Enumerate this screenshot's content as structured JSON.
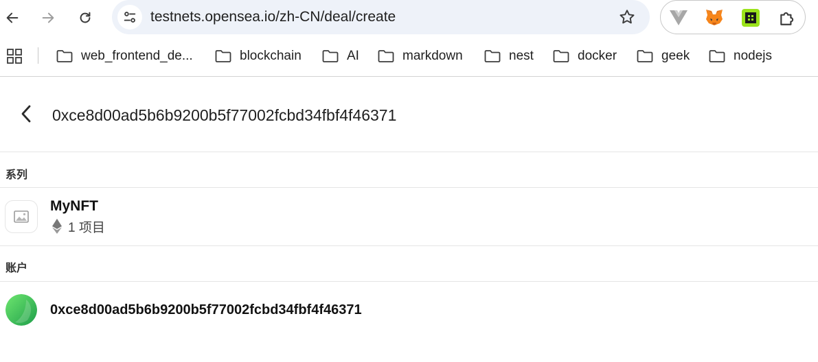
{
  "browser": {
    "url": "testnets.opensea.io/zh-CN/deal/create",
    "extensions": [
      "vue-devtools-icon",
      "metamask-fox-icon",
      "green-square-extension-icon",
      "puzzle-piece-icon"
    ],
    "bookmarks": [
      {
        "label": "web_frontend_de..."
      },
      {
        "label": "blockchain"
      },
      {
        "label": "AI"
      },
      {
        "label": "markdown"
      },
      {
        "label": "nest"
      },
      {
        "label": "docker"
      },
      {
        "label": "geek"
      },
      {
        "label": "nodejs"
      }
    ]
  },
  "page": {
    "deal_address_input": "0xce8d00ad5b6b9200b5f77002fcbd34fbf4f46371",
    "collection_section_label": "系列",
    "collection": {
      "name": "MyNFT",
      "item_count": "1 项目",
      "chain_icon": "ethereum-icon"
    },
    "account_section_label": "账户",
    "account": {
      "address": "0xce8d00ad5b6b9200b5f77002fcbd34fbf4f46371"
    }
  },
  "colors": {
    "omnibox_bg": "#eef2f9",
    "spellcheck_underline": "#e53935",
    "avatar_gradient_start": "#4cd964",
    "avatar_gradient_end": "#1fa84f"
  }
}
